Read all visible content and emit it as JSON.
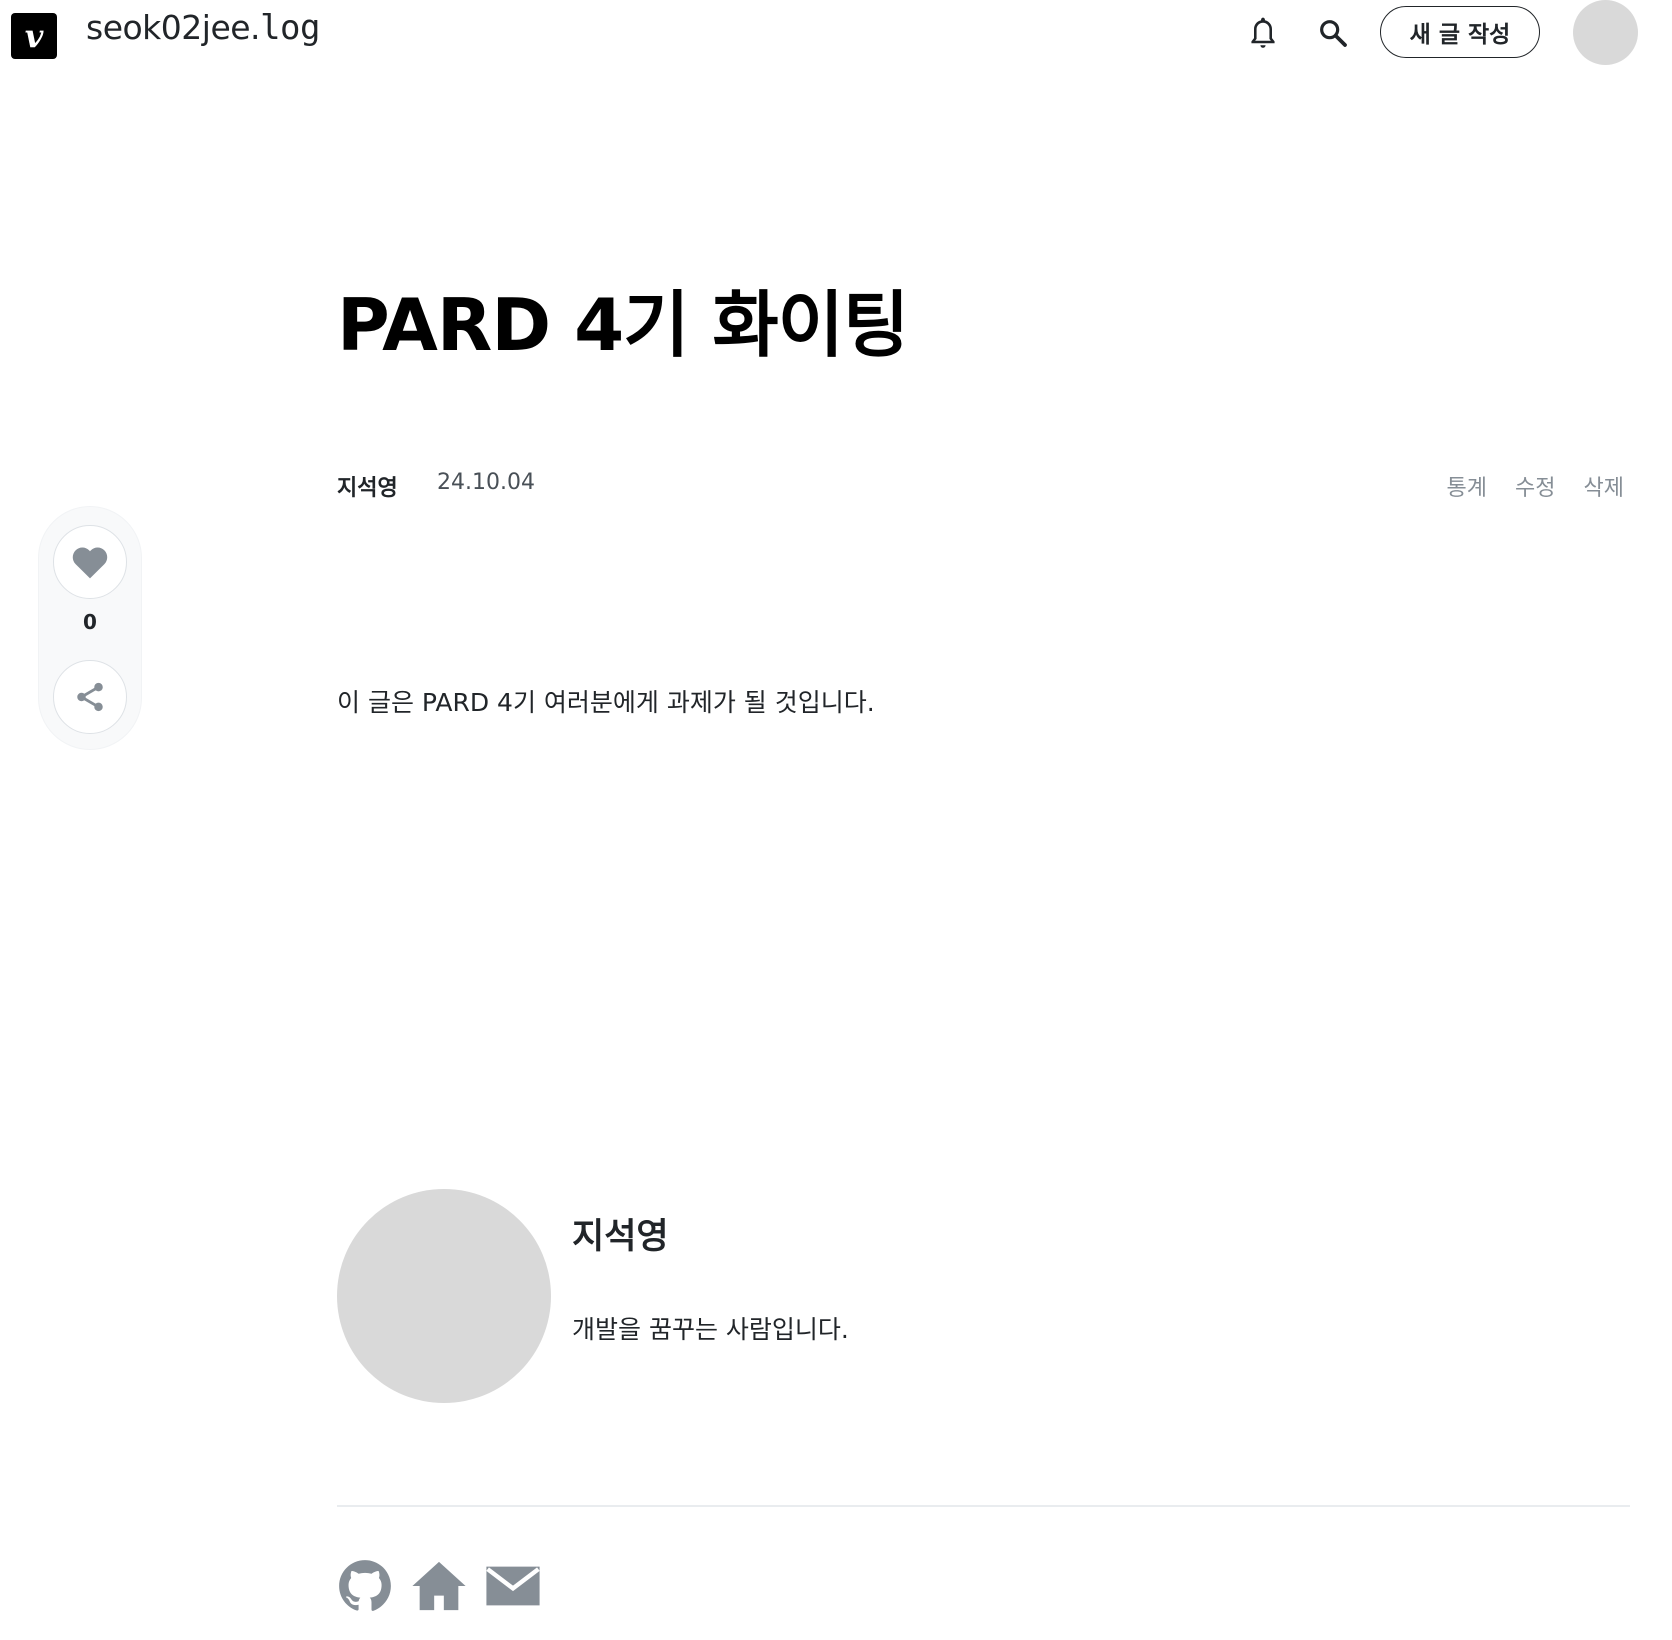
{
  "header": {
    "logo_letter": "v",
    "blog_name": "seok02jee.",
    "blog_suffix": "log",
    "write_button": "새 글 작성",
    "icons": [
      "bell-icon",
      "search-icon"
    ]
  },
  "post": {
    "title": "PARD 4기 화이팅",
    "author": "지석영",
    "date": "24.10.04",
    "actions": {
      "stats": "통계",
      "edit": "수정",
      "delete": "삭제"
    },
    "body": "이 글은 PARD 4기 여러분에게 과제가 될 것입니다."
  },
  "side": {
    "like_count": "0",
    "icons": [
      "heart-icon",
      "share-icon"
    ]
  },
  "profile": {
    "name": "지석영",
    "bio": "개발을 꿈꾸는 사람입니다.",
    "social_icons": [
      "github-icon",
      "home-icon",
      "mail-icon"
    ]
  },
  "colors": {
    "text": "#212529",
    "muted": "#868e96",
    "icon_gray": "#868e96",
    "avatar_placeholder": "#d9d9d9",
    "panel_bg": "#f8f9fa"
  }
}
